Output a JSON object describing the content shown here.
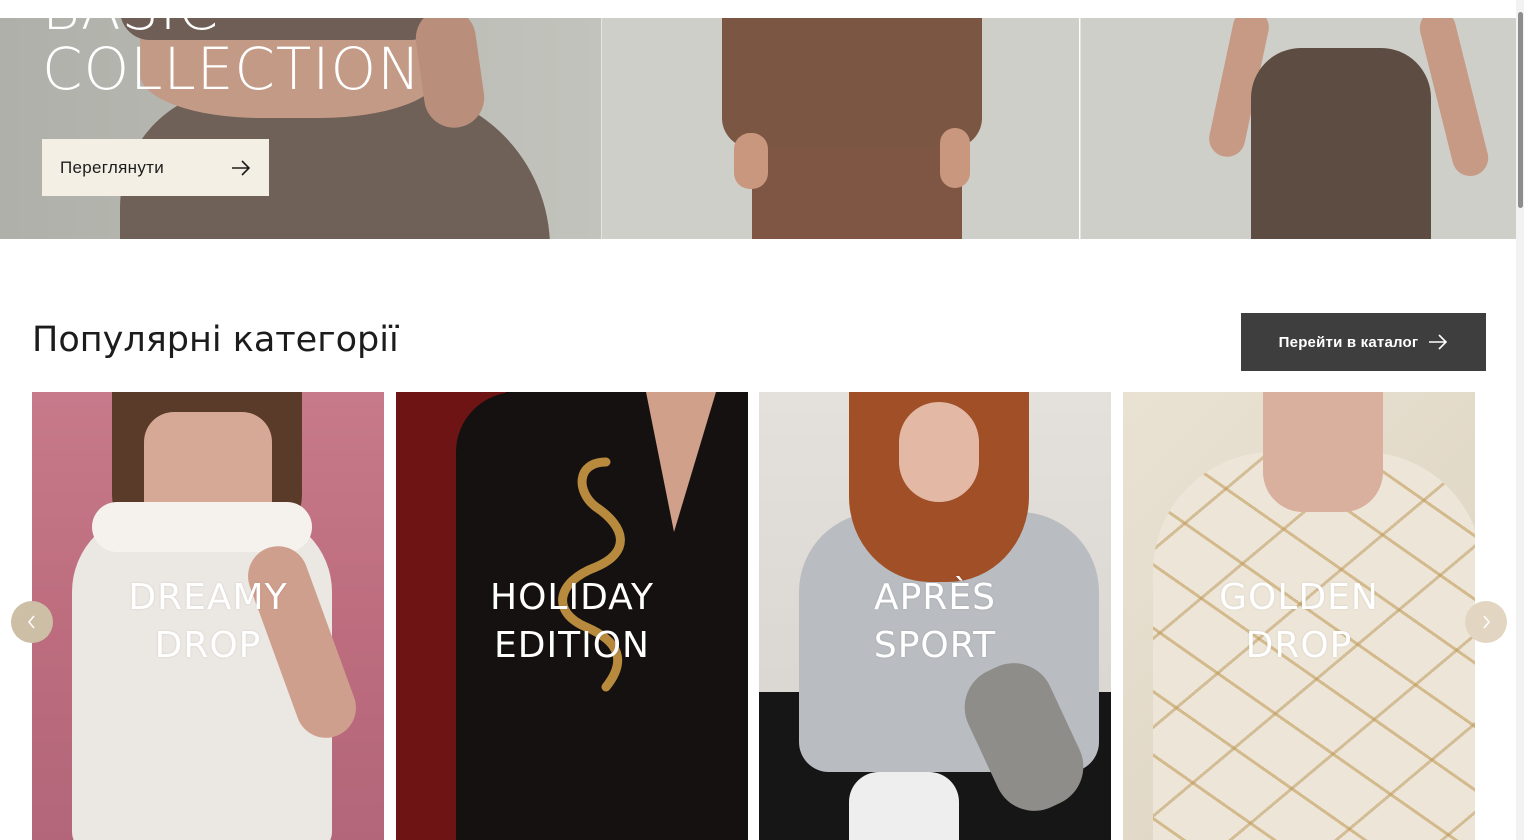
{
  "hero": {
    "title_partial": "BASIC",
    "title": "COLLECTION",
    "view_button_label": "Переглянути"
  },
  "section": {
    "title": "Популярні категорії",
    "catalog_button_label": "Перейти в каталог"
  },
  "categories": [
    {
      "line1": "DREAMY",
      "line2": "DROP"
    },
    {
      "line1": "HOLIDAY",
      "line2": "EDITION"
    },
    {
      "line1": "APRÈS",
      "line2": "SPORT"
    },
    {
      "line1": "GOLDEN",
      "line2": "DROP"
    }
  ],
  "slider": {
    "prev_icon": "chevron-left-icon",
    "next_icon": "chevron-right-icon"
  },
  "colors": {
    "hero_button_bg": "#f4efe5",
    "catalog_button_bg": "#3e3e3e",
    "slider_button_bg": "#cdbfa5"
  }
}
